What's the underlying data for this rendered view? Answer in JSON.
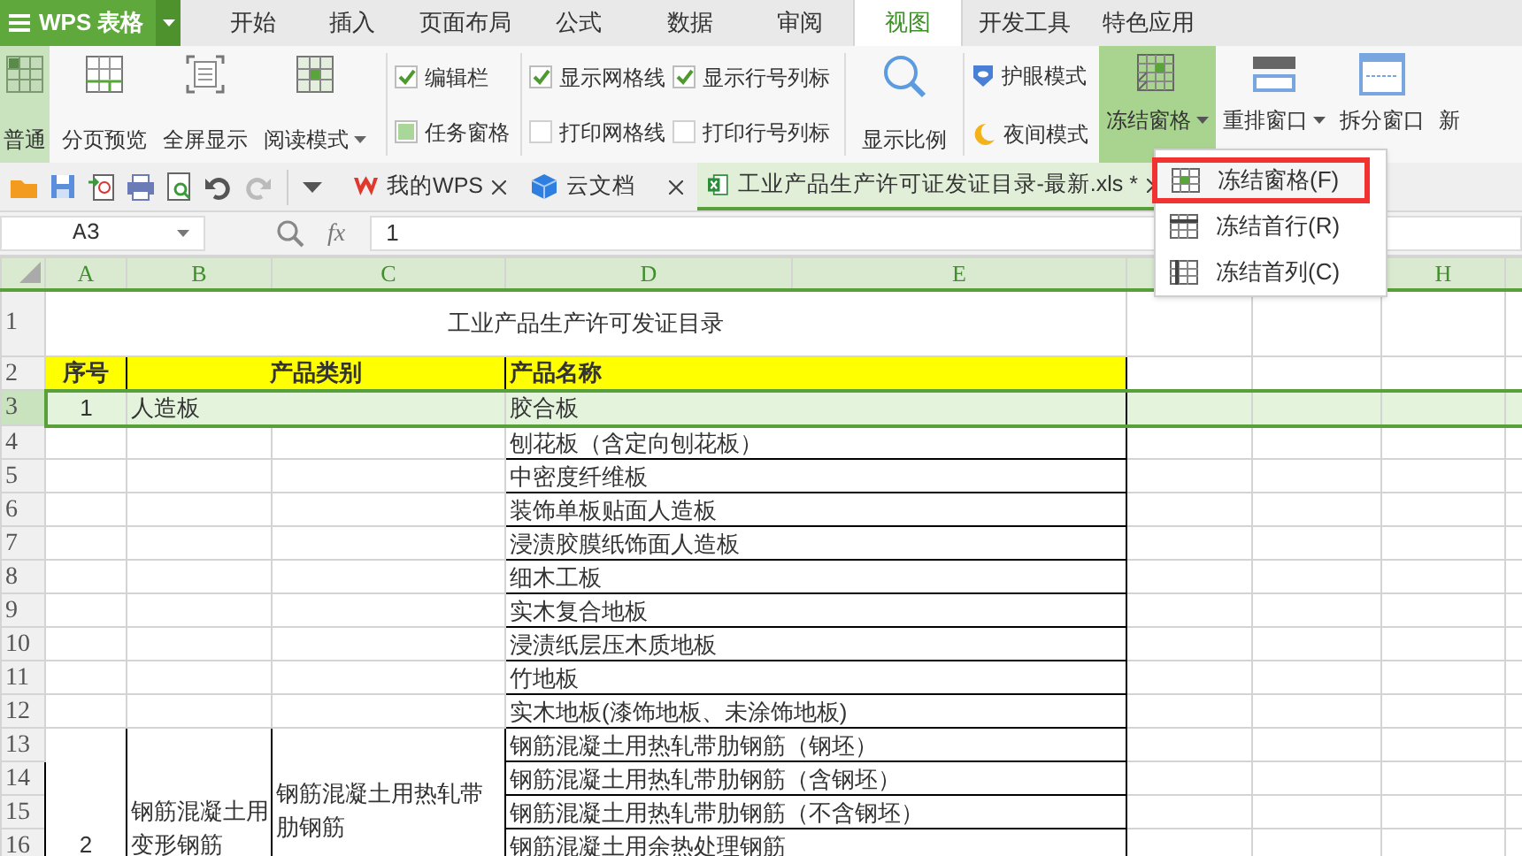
{
  "app": {
    "logo": "WPS 表格"
  },
  "menu_tabs": [
    {
      "label": "开始",
      "selected": false
    },
    {
      "label": "插入",
      "selected": false
    },
    {
      "label": "页面布局",
      "selected": false
    },
    {
      "label": "公式",
      "selected": false
    },
    {
      "label": "数据",
      "selected": false
    },
    {
      "label": "审阅",
      "selected": false
    },
    {
      "label": "视图",
      "selected": true
    },
    {
      "label": "开发工具",
      "selected": false
    },
    {
      "label": "特色应用",
      "selected": false
    }
  ],
  "view_buttons": [
    {
      "label": "普通",
      "selected": true,
      "dropdown": false
    },
    {
      "label": "分页预览",
      "selected": false,
      "dropdown": false
    },
    {
      "label": "全屏显示",
      "selected": false,
      "dropdown": false
    },
    {
      "label": "阅读模式",
      "selected": false,
      "dropdown": true
    }
  ],
  "checkbox_columns": [
    [
      {
        "label": "编辑栏",
        "checked": true,
        "kind": "tick"
      },
      {
        "label": "任务窗格",
        "checked": true,
        "kind": "square"
      }
    ],
    [
      {
        "label": "显示网格线",
        "checked": true,
        "kind": "tick"
      },
      {
        "label": "打印网格线",
        "checked": false
      }
    ],
    [
      {
        "label": "显示行号列标",
        "checked": true,
        "kind": "tick"
      },
      {
        "label": "打印行号列标",
        "checked": false
      }
    ]
  ],
  "zoom_button": {
    "label": "显示比例"
  },
  "modes": [
    {
      "label": "护眼模式",
      "kind": "eye"
    },
    {
      "label": "夜间模式",
      "kind": "moon"
    }
  ],
  "window_buttons": [
    {
      "label": "冻结窗格",
      "selected": true,
      "dropdown": true,
      "kind": "freeze"
    },
    {
      "label": "重排窗口",
      "selected": false,
      "dropdown": true,
      "kind": "arrange"
    },
    {
      "label": "拆分窗口",
      "selected": false,
      "dropdown": false,
      "kind": "split"
    },
    {
      "label": "新",
      "selected": false,
      "dropdown": false,
      "kind": "none"
    }
  ],
  "doc_tabs": [
    {
      "label": "我的WPS",
      "kind": "wps",
      "selected": false
    },
    {
      "label": "云文档",
      "kind": "cloud",
      "selected": false
    },
    {
      "label": "工业产品生产许可证发证目录-最新.xls *",
      "kind": "sheet",
      "selected": true
    }
  ],
  "name_box": "A3",
  "function_label": "fx",
  "formula": "1",
  "columns": [
    {
      "label": "A",
      "kind": "header"
    },
    {
      "label": "B",
      "kind": "header"
    },
    {
      "label": "C",
      "kind": "header"
    },
    {
      "label": "D",
      "kind": "header"
    },
    {
      "label": "E",
      "kind": "header"
    },
    {
      "kind": "covered"
    },
    {
      "kind": "covered"
    },
    {
      "label": "H",
      "kind": "header"
    }
  ],
  "row_numbers": [
    {
      "label": "1",
      "selected": false
    },
    {
      "label": "2",
      "selected": false
    },
    {
      "label": "3",
      "selected": true
    },
    {
      "label": "4",
      "selected": false
    },
    {
      "label": "5",
      "selected": false
    },
    {
      "label": "6",
      "selected": false
    },
    {
      "label": "7",
      "selected": false
    },
    {
      "label": "8",
      "selected": false
    },
    {
      "label": "9",
      "selected": false
    },
    {
      "label": "10",
      "selected": false
    },
    {
      "label": "11",
      "selected": false
    },
    {
      "label": "12",
      "selected": false
    },
    {
      "label": "13",
      "selected": false
    },
    {
      "label": "14",
      "selected": false
    },
    {
      "label": "15",
      "selected": false
    },
    {
      "label": "16",
      "selected": false
    }
  ],
  "sheet_title": "工业产品生产许可发证目录",
  "headers": [
    "序号",
    "产品类别",
    "产品名称"
  ],
  "groups": [
    {
      "index": "1",
      "category": "人造板",
      "products": [
        "胶合板",
        "刨花板（含定向刨花板）",
        "中密度纤维板",
        "装饰单板贴面人造板",
        "浸渍胶膜纸饰面人造板",
        "细木工板",
        "实木复合地板",
        "浸渍纸层压木质地板",
        "竹地板",
        "实木地板(漆饰地板、未涂饰地板)"
      ]
    },
    {
      "index": "2",
      "category": "钢筋混凝土用变形钢筋",
      "subcategory": "钢筋混凝土用热轧带肋钢筋",
      "products": [
        "钢筋混凝土用热轧带肋钢筋（钢坯）",
        "钢筋混凝土用热轧带肋钢筋（含钢坯）",
        "钢筋混凝土用热轧带肋钢筋（不含钢坯）",
        "钢筋混凝土用余热处理钢筋"
      ]
    }
  ],
  "freeze_menu": [
    {
      "label": "冻结窗格(F)",
      "selected": true
    },
    {
      "label": "冻结首行(R)",
      "selected": false
    },
    {
      "label": "冻结首列(C)",
      "selected": false
    }
  ]
}
